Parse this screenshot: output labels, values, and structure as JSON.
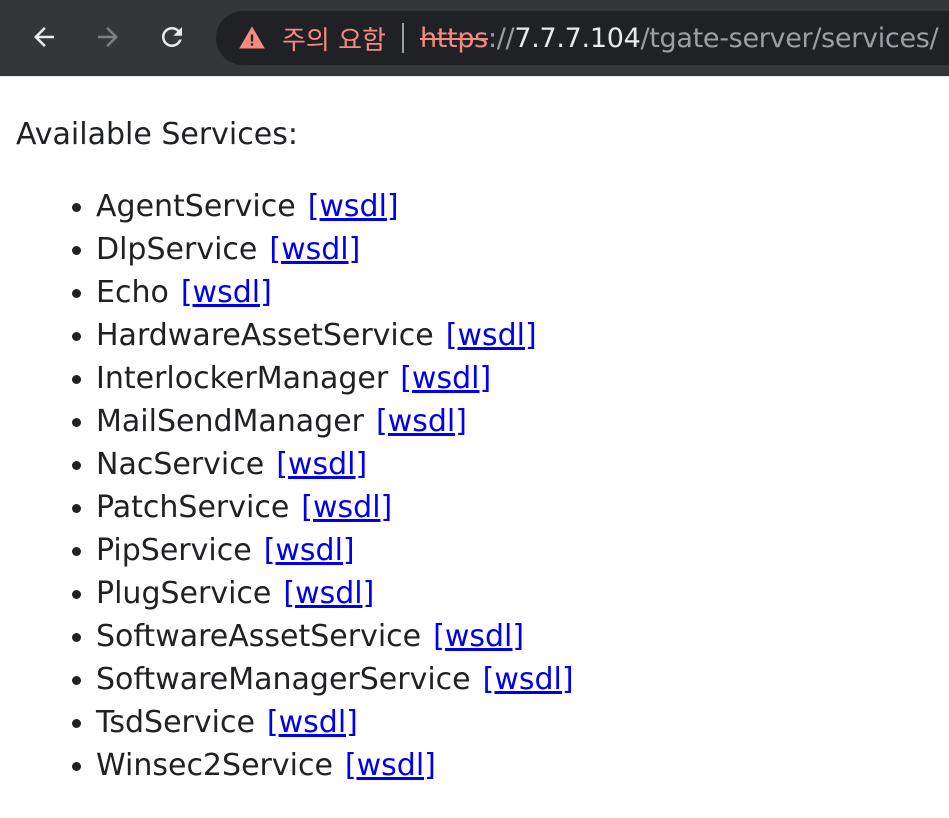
{
  "browser": {
    "warning_label": "주의 요함",
    "url": {
      "scheme": "https",
      "slashes": "://",
      "host": "7.7.7.104",
      "path": "/tgate-server/services/"
    },
    "colors": {
      "toolbar_bg": "#35363a",
      "omnibox_bg": "#202124",
      "warning": "#f28b82"
    }
  },
  "page": {
    "heading": "Available Services:",
    "link_label": "[wsdl]",
    "link_color": "#0000ee",
    "services": [
      "AgentService",
      "DlpService",
      "Echo",
      "HardwareAssetService",
      "InterlockerManager",
      "MailSendManager",
      "NacService",
      "PatchService",
      "PipService",
      "PlugService",
      "SoftwareAssetService",
      "SoftwareManagerService",
      "TsdService",
      "Winsec2Service"
    ]
  }
}
